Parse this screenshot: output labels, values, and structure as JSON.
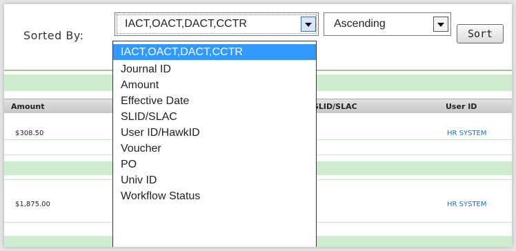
{
  "sort": {
    "label": "Sorted By:",
    "selected": "IACT,OACT,DACT,CCTR",
    "order": "Ascending",
    "button": "Sort"
  },
  "dropdown": {
    "options": [
      "IACT,OACT,DACT,CCTR",
      "Journal ID",
      "Amount",
      "Effective Date",
      "SLID/SLAC",
      "User ID/HawkID",
      "Voucher",
      "PO",
      "Univ ID",
      "Workflow Status"
    ]
  },
  "table": {
    "headers": {
      "amount": "Amount",
      "slid": "SLID/SLAC",
      "userid": "User ID"
    },
    "rows": [
      {
        "amount": "$308.50",
        "userid": "HR SYSTEM"
      },
      {
        "amount": "$1,875.00",
        "userid": "HR SYSTEM"
      }
    ]
  },
  "colors": {
    "highlight": "#3399ff",
    "band": "#cfeccf",
    "link": "#1b6fc4"
  }
}
